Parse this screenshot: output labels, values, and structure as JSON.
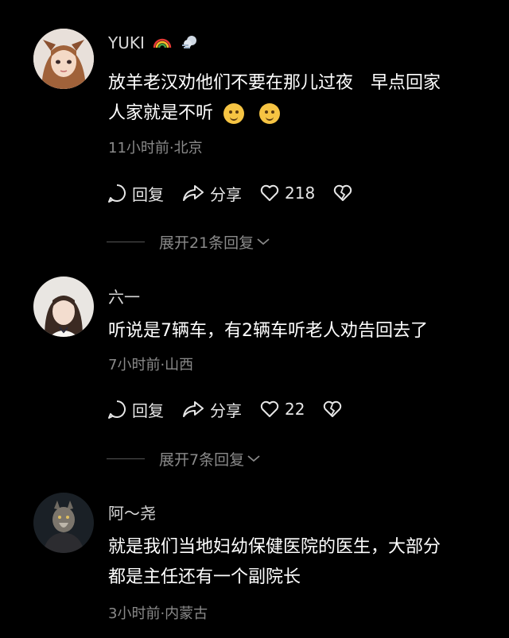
{
  "comments": [
    {
      "username": "YUKI",
      "badges": [
        "rainbow-icon",
        "wind-icon"
      ],
      "text_line1": "放羊老汉劝他们不要在那儿过夜　早点回家",
      "text_line2": "人家就是不听",
      "meta": "11小时前·北京",
      "reply_label": "回复",
      "share_label": "分享",
      "likes": "218",
      "expand_label": "展开21条回复"
    },
    {
      "username": "六一",
      "text_line1": "听说是7辆车，有2辆车听老人劝告回去了",
      "meta": "7小时前·山西",
      "reply_label": "回复",
      "share_label": "分享",
      "likes": "22",
      "expand_label": "展开7条回复"
    },
    {
      "username": "阿～尧",
      "text_line1": "就是我们当地妇幼保健医院的医生，大部分",
      "text_line2": "都是主任还有一个副院长",
      "meta": "3小时前·内蒙古"
    }
  ],
  "colors": {
    "background": "#000000",
    "meta": "#8a8a8a",
    "text": "#ffffff"
  }
}
